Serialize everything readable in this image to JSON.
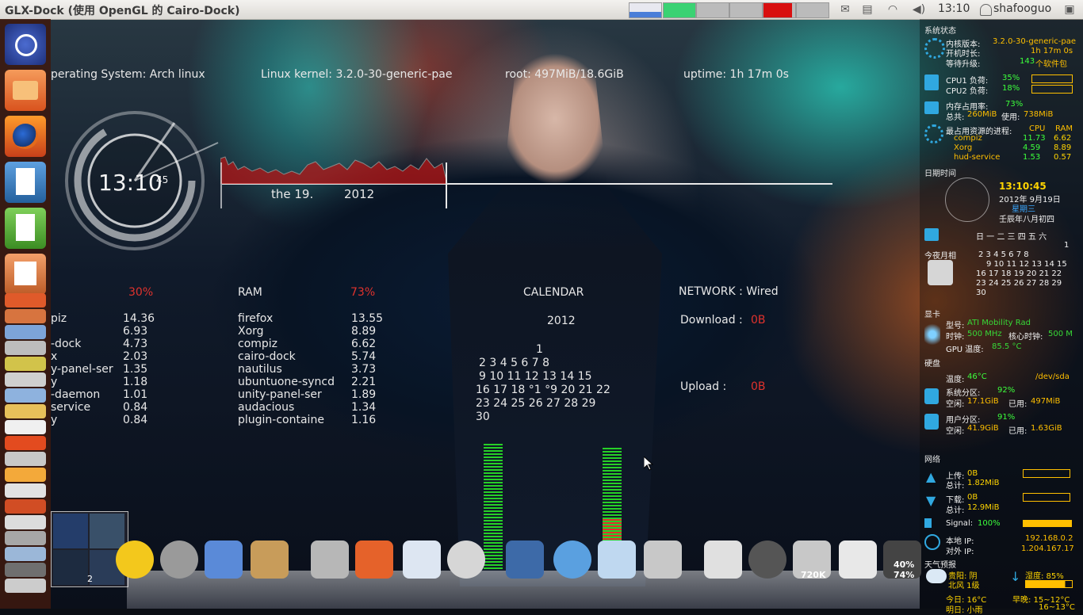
{
  "topbar": {
    "window_title": "GLX-Dock (使用 OpenGL 的 Cairo-Dock)",
    "clock": "13:10",
    "user": "shafooguo",
    "tray_icons": [
      "mail-icon",
      "clipboard-icon",
      "wifi-icon",
      "volume-icon",
      "power-icon"
    ]
  },
  "conky": {
    "header": {
      "os": "perating System:  Arch linux",
      "kernel": "Linux kernel:  3.2.0-30-generic-pae",
      "root": "root:  497MiB/18.6GiB",
      "uptime": "uptime:  1h 17m 0s"
    },
    "clock": {
      "time": "13:10",
      "seconds": "45",
      "date_prefix": "the 19.",
      "year": "2012"
    },
    "cpu": {
      "percent": "30%",
      "processes": [
        {
          "name": "piz",
          "value": "14.36"
        },
        {
          "name": "",
          "value": "6.93"
        },
        {
          "name": "-dock",
          "value": "4.73"
        },
        {
          "name": "x",
          "value": "2.03"
        },
        {
          "name": "y-panel-ser",
          "value": "1.35"
        },
        {
          "name": "y",
          "value": "1.18"
        },
        {
          "name": "-daemon",
          "value": "1.01"
        },
        {
          "name": "service",
          "value": "0.84"
        },
        {
          "name": "y",
          "value": "0.84"
        }
      ]
    },
    "ram": {
      "label": "RAM",
      "percent": "73%",
      "processes": [
        {
          "name": "firefox",
          "value": "13.55"
        },
        {
          "name": "Xorg",
          "value": "8.89"
        },
        {
          "name": "compiz",
          "value": "6.62"
        },
        {
          "name": "cairo-dock",
          "value": "5.74"
        },
        {
          "name": "nautilus",
          "value": "3.73"
        },
        {
          "name": "ubuntuone-syncd",
          "value": "2.21"
        },
        {
          "name": "unity-panel-ser",
          "value": "1.89"
        },
        {
          "name": "audacious",
          "value": "1.34"
        },
        {
          "name": "plugin-containe",
          "value": "1.16"
        }
      ]
    },
    "calendar": {
      "label": "CALENDAR",
      "year": "2012",
      "rows": [
        "1",
        "2  3  4  5  6  7  8",
        "9 10 11 12 13 14 15",
        "16 17 18  °1  °9 20 21 22",
        "23 24 25 26 27 28 29",
        "30"
      ]
    },
    "network": {
      "label": "NETWORK  :  Wired",
      "download_label": "Download :",
      "download_value": "0B",
      "upload_label": "Upload    :",
      "upload_value": "0B"
    }
  },
  "rpanel": {
    "sys_title": "系统状态",
    "kernel_label": "内核版本:",
    "kernel_value": "3.2.0-30-generic-pae",
    "uptime_label": "开机时长:",
    "uptime_value": "1h 17m 0s",
    "upgrade_label": "等待升级:",
    "upgrade_value": "143",
    "upgrade_unit": "个软件包",
    "cpu1_label": "CPU1 负荷:",
    "cpu1_value": "35%",
    "cpu2_label": "CPU2 负荷:",
    "cpu2_value": "18%",
    "mem_label": "内存占用率:",
    "mem_value": "73%",
    "mem_total_label": "总共:",
    "mem_total": "260MiB",
    "mem_used_label": "使用:",
    "mem_used": "738MiB",
    "top_label": "最占用资源的进程:",
    "top_cpu": "CPU",
    "top_ram": "RAM",
    "top_procs": [
      {
        "name": "compiz",
        "cpu": "11.73",
        "ram": "6.62"
      },
      {
        "name": "Xorg",
        "cpu": "4.59",
        "ram": "8.89"
      },
      {
        "name": "hud-service",
        "cpu": "1.53",
        "ram": "0.57"
      }
    ],
    "date_title": "日期时间",
    "time": "13:10:45",
    "date": "2012年 9月19日",
    "weekday": "星期三",
    "lunar": "壬辰年八月初四",
    "cal_header": "日 一 二 三 四 五 六",
    "cal_rows": [
      "1",
      "2  3  4  5  6  7  8",
      "9 10 11 12 13 14 15",
      "16 17 18 19 20 21 22",
      "23 24 25 26 27 28 29",
      "30"
    ],
    "moon_label": "今夜月相",
    "gpu_title": "显卡",
    "gpu_model_label": "型号:",
    "gpu_model": "ATI Mobility Rad",
    "gpu_clock_label": "时钟:",
    "gpu_clock": "500 MHz",
    "gpu_core_label": "核心时钟:",
    "gpu_core": "500 M",
    "gpu_temp_label": "GPU 温度:",
    "gpu_temp": "85.5 °C",
    "disk_title": "硬盘",
    "disk_temp_label": "温度:",
    "disk_temp": "46°C",
    "disk_dev": "/dev/sda",
    "sys_part_label": "系统分区:",
    "sys_part": "92%",
    "sys_free_label": "空闲:",
    "sys_free": "17.1GiB",
    "sys_used_label": "已用:",
    "sys_used": "497MiB",
    "user_part_label": "用户分区:",
    "user_part": "91%",
    "user_free_label": "空闲:",
    "user_free": "41.9GiB",
    "user_used_label": "已用:",
    "user_used": "1.63GiB",
    "net_title": "网络",
    "up_label": "上传:",
    "up_value": "0B",
    "up_total_label": "总计:",
    "up_total": "1.82MiB",
    "down_label": "下载:",
    "down_value": "0B",
    "down_total_label": "总计:",
    "down_total": "12.9MiB",
    "signal_label": "Signal:",
    "signal_value": "100%",
    "local_ip_label": "本地 IP:",
    "local_ip": "192.168.0.2",
    "ext_ip_label": "对外 IP:",
    "ext_ip": "1.204.167.17",
    "weather_title": "天气预报",
    "city": "贵阳: 阴",
    "wind": "北风 1级",
    "humidity": "湿度:  85%",
    "today_label": "今日: 16°C",
    "morning_label": "早晚:  15~12°C",
    "tomorrow_label": "明日: 小雨",
    "tomorrow_range": "16~13°C"
  },
  "dock": {
    "badge_720": "720K",
    "cpu_pct": "40%",
    "ram_pct": "74%",
    "desktop_count": "2",
    "icons": [
      "star-icon",
      "time-machine-icon",
      "finder-icon",
      "package-icon",
      "gimp-icon",
      "home-icon",
      "writer-doc-icon",
      "disc-burner-icon",
      "stamp-mail-icon",
      "safari-icon",
      "chat-icon",
      "calculator-icon",
      "at-sign-icon",
      "clock-icon",
      "trash-icon",
      "switch-icon",
      "system-monitor-icon"
    ]
  },
  "colors": {
    "accent_red": "#e0322d",
    "green": "#3cff3c",
    "orange": "#ffbf00"
  }
}
